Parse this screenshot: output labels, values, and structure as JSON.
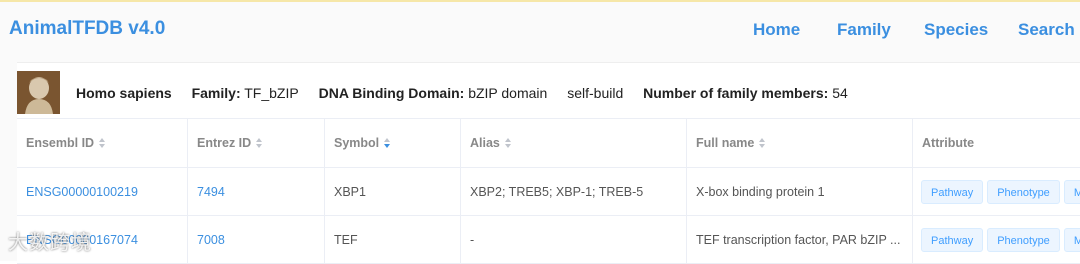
{
  "header": {
    "brand": "AnimalTFDB v4.0",
    "nav": [
      "Home",
      "Family",
      "Species",
      "Search"
    ]
  },
  "info": {
    "species": "Homo sapiens",
    "family_label": "Family:",
    "family_value": "TF_bZIP",
    "dbd_label": "DNA Binding Domain:",
    "dbd_value": "bZIP domain",
    "source": "self-build",
    "members_label": "Number of family members:",
    "members_value": "54"
  },
  "table": {
    "columns": [
      "Ensembl ID",
      "Entrez ID",
      "Symbol",
      "Alias",
      "Full name",
      "Attribute"
    ],
    "rows": [
      {
        "ensembl": "ENSG00000100219",
        "entrez": "7494",
        "symbol": "XBP1",
        "alias": "XBP2; TREB5; XBP-1; TREB-5",
        "fullname": "X-box binding protein 1",
        "tags": [
          "Pathway",
          "Phenotype",
          "Mu"
        ]
      },
      {
        "ensembl": "ENSG00000167074",
        "entrez": "7008",
        "symbol": "TEF",
        "alias": "-",
        "fullname": "TEF transcription factor, PAR bZIP ...",
        "tags": [
          "Pathway",
          "Phenotype",
          "Mu"
        ]
      }
    ]
  },
  "watermark": "大数跨境",
  "colors": {
    "accent": "#3b8fe0",
    "tag_bg": "#ecf5ff"
  }
}
